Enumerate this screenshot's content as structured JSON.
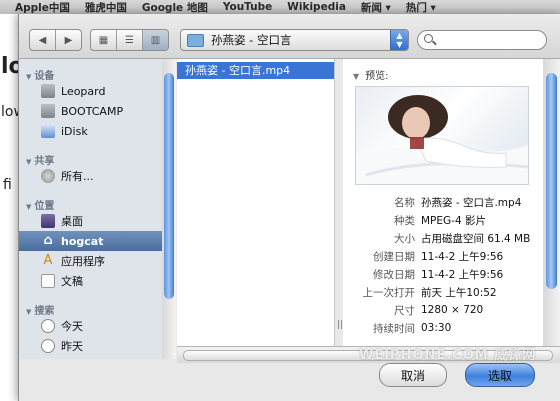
{
  "bookmarks": [
    "Apple中国",
    "雅虎中国",
    "Google 地图",
    "YouTube",
    "Wikipedia",
    "新闻 ▾",
    "热门 ▾"
  ],
  "toolbar": {
    "path": "孙燕姿 - 空口言"
  },
  "sidebar": {
    "sections": [
      {
        "title": "设备",
        "items": [
          "Leopard",
          "BOOTCAMP",
          "iDisk"
        ]
      },
      {
        "title": "共享",
        "items": [
          "所有..."
        ]
      },
      {
        "title": "位置",
        "items": [
          "桌面",
          "hogcat",
          "应用程序",
          "文稿"
        ]
      },
      {
        "title": "搜索",
        "items": [
          "今天",
          "昨天"
        ]
      }
    ],
    "selected": "hogcat"
  },
  "file_list": {
    "items": [
      "孙燕姿 - 空口言.mp4"
    ]
  },
  "preview": {
    "title": "预览:",
    "info": [
      {
        "label": "名称",
        "value": "孙燕姿 - 空口言.mp4"
      },
      {
        "label": "种类",
        "value": "MPEG-4 影片"
      },
      {
        "label": "大小",
        "value": "占用磁盘空间 61.4 MB"
      },
      {
        "label": "创建日期",
        "value": "11-4-2 上午9:56"
      },
      {
        "label": "修改日期",
        "value": "11-4-2 上午9:56"
      },
      {
        "label": "上一次打开",
        "value": "前天 上午10:52"
      },
      {
        "label": "尺寸",
        "value": "1280 × 720"
      },
      {
        "label": "持续时间",
        "value": "03:30"
      }
    ]
  },
  "buttons": {
    "cancel": "取消",
    "ok": "选取"
  },
  "watermark": "WEIPHONE.COM 威锋网"
}
